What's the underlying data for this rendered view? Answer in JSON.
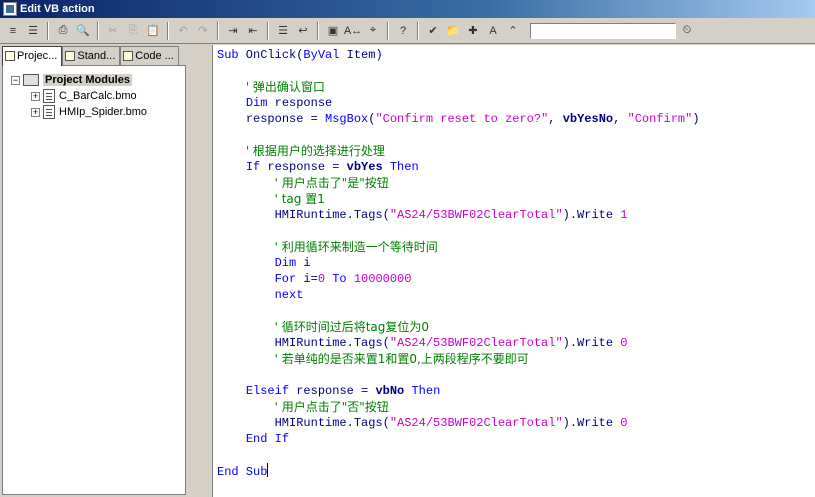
{
  "window": {
    "title": "Edit VB action"
  },
  "toolbar": {
    "buttons": [
      {
        "name": "indent-list-button",
        "glyph": "≡"
      },
      {
        "name": "outdent-list-button",
        "glyph": "☰"
      },
      {
        "name": "print-button",
        "glyph": "⎙"
      },
      {
        "name": "print-preview-button",
        "glyph": "🔍"
      },
      {
        "name": "cut-button",
        "glyph": "✂"
      },
      {
        "name": "copy-button",
        "glyph": "⎘"
      },
      {
        "name": "paste-button",
        "glyph": "📋"
      },
      {
        "name": "undo-button",
        "glyph": "↶"
      },
      {
        "name": "redo-button",
        "glyph": "↷"
      },
      {
        "name": "indent-button",
        "glyph": "⇥"
      },
      {
        "name": "outdent-button",
        "glyph": "⇤"
      },
      {
        "name": "comment-button",
        "glyph": "☰"
      },
      {
        "name": "uncomment-button",
        "glyph": "↩"
      },
      {
        "name": "find-button",
        "glyph": "▣"
      },
      {
        "name": "replace-button",
        "glyph": "A↔"
      },
      {
        "name": "goto-button",
        "glyph": "⌖"
      },
      {
        "name": "help-button",
        "glyph": "?"
      },
      {
        "name": "check-syntax-button",
        "glyph": "✔"
      },
      {
        "name": "open-folder-button",
        "glyph": "📁"
      },
      {
        "name": "new-module-button",
        "glyph": "✚"
      },
      {
        "name": "tag-button",
        "glyph": "A"
      },
      {
        "name": "compass-button",
        "glyph": "⌃"
      },
      {
        "name": "clock-button",
        "glyph": "⏲"
      }
    ]
  },
  "sidebar": {
    "tabs": [
      "Projec...",
      "Stand...",
      "Code ..."
    ],
    "tree": {
      "root": "Project Modules",
      "children": [
        "C_BarCalc.bmo",
        "HMIp_Spider.bmo"
      ]
    }
  },
  "editor": {
    "lines": [
      {
        "indent": "",
        "parts": [
          [
            "kw",
            "Sub"
          ],
          [
            "plain",
            " OnClick("
          ],
          [
            "kw",
            "ByVal"
          ],
          [
            "plain",
            " Item)"
          ]
        ]
      },
      {
        "indent": "",
        "parts": []
      },
      {
        "indent": "    ",
        "parts": [
          [
            "cm",
            "' 弹出确认窗口"
          ]
        ]
      },
      {
        "indent": "    ",
        "parts": [
          [
            "kw",
            "Dim"
          ],
          [
            "plain",
            " response"
          ]
        ]
      },
      {
        "indent": "    ",
        "parts": [
          [
            "plain",
            "response = "
          ],
          [
            "kw",
            "MsgBox"
          ],
          [
            "plain",
            "("
          ],
          [
            "str",
            "\"Confirm reset to zero?\""
          ],
          [
            "plain",
            ", "
          ],
          [
            "bold",
            "vbYesNo"
          ],
          [
            "plain",
            ", "
          ],
          [
            "str",
            "\"Confirm\""
          ],
          [
            "plain",
            ")"
          ]
        ]
      },
      {
        "indent": "",
        "parts": []
      },
      {
        "indent": "    ",
        "parts": [
          [
            "cm",
            "' 根据用户的选择进行处理"
          ]
        ]
      },
      {
        "indent": "    ",
        "parts": [
          [
            "kw",
            "If"
          ],
          [
            "plain",
            " response = "
          ],
          [
            "bold",
            "vbYes"
          ],
          [
            "plain",
            " "
          ],
          [
            "kw",
            "Then"
          ]
        ]
      },
      {
        "indent": "        ",
        "parts": [
          [
            "cm",
            "' 用户点击了\"是\"按钮"
          ]
        ]
      },
      {
        "indent": "        ",
        "parts": [
          [
            "cm",
            "' tag 置1"
          ]
        ]
      },
      {
        "indent": "        ",
        "parts": [
          [
            "plain",
            "HMIRuntime.Tags("
          ],
          [
            "str",
            "\"AS24/53BWF02ClearTotal\""
          ],
          [
            "plain",
            ").Write "
          ],
          [
            "num",
            "1"
          ]
        ]
      },
      {
        "indent": "",
        "parts": []
      },
      {
        "indent": "        ",
        "parts": [
          [
            "cm",
            "' 利用循环来制造一个等待时间"
          ]
        ]
      },
      {
        "indent": "        ",
        "parts": [
          [
            "kw",
            "Dim"
          ],
          [
            "plain",
            " i"
          ]
        ]
      },
      {
        "indent": "        ",
        "parts": [
          [
            "kw",
            "For"
          ],
          [
            "plain",
            " i="
          ],
          [
            "num",
            "0"
          ],
          [
            "plain",
            " "
          ],
          [
            "kw",
            "To"
          ],
          [
            "plain",
            " "
          ],
          [
            "num",
            "10000000"
          ]
        ]
      },
      {
        "indent": "        ",
        "parts": [
          [
            "kw",
            "next"
          ]
        ]
      },
      {
        "indent": "",
        "parts": []
      },
      {
        "indent": "        ",
        "parts": [
          [
            "cm",
            "' 循环时间过后将tag复位为0"
          ]
        ]
      },
      {
        "indent": "        ",
        "parts": [
          [
            "plain",
            "HMIRuntime.Tags("
          ],
          [
            "str",
            "\"AS24/53BWF02ClearTotal\""
          ],
          [
            "plain",
            ").Write "
          ],
          [
            "num",
            "0"
          ]
        ]
      },
      {
        "indent": "        ",
        "parts": [
          [
            "cm",
            "' 若单纯的是否来置1和置0,上两段程序不要即可"
          ]
        ]
      },
      {
        "indent": "",
        "parts": []
      },
      {
        "indent": "    ",
        "parts": [
          [
            "kw",
            "Elseif"
          ],
          [
            "plain",
            " response = "
          ],
          [
            "bold",
            "vbNo"
          ],
          [
            "plain",
            " "
          ],
          [
            "kw",
            "Then"
          ]
        ]
      },
      {
        "indent": "        ",
        "parts": [
          [
            "cm",
            "' 用户点击了\"否\"按钮"
          ]
        ]
      },
      {
        "indent": "        ",
        "parts": [
          [
            "plain",
            "HMIRuntime.Tags("
          ],
          [
            "str",
            "\"AS24/53BWF02ClearTotal\""
          ],
          [
            "plain",
            ").Write "
          ],
          [
            "num",
            "0"
          ]
        ]
      },
      {
        "indent": "    ",
        "parts": [
          [
            "kw",
            "End If"
          ]
        ]
      },
      {
        "indent": "",
        "parts": []
      },
      {
        "indent": "",
        "parts": [
          [
            "kw",
            "End Sub"
          ]
        ],
        "caret": true
      }
    ]
  }
}
